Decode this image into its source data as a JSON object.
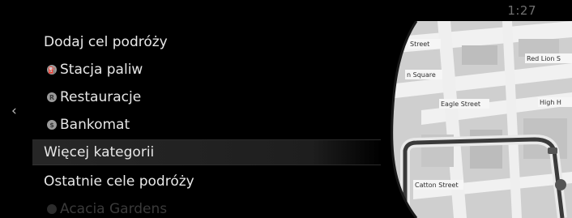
{
  "status_bar": {
    "time": "1:27"
  },
  "navigation": {
    "back_icon": "chevron-left-icon"
  },
  "menu": {
    "add_destination_header": "Dodaj cel podróży",
    "categories": [
      {
        "label": "Stacja paliw",
        "icon": "fuel-station-icon",
        "glyph": "⛽"
      },
      {
        "label": "Restauracje",
        "icon": "restaurant-icon",
        "glyph": "R"
      },
      {
        "label": "Bankomat",
        "icon": "atm-icon",
        "glyph": "$"
      }
    ],
    "more_categories": "Więcej kategorii",
    "recent_header": "Ostatnie cele podróży",
    "recent_items": [
      {
        "label": "Acacia Gardens",
        "icon": "place-icon"
      }
    ]
  },
  "map": {
    "street_labels": [
      "Street",
      "Red Lion S",
      "n Square",
      "Eagle Street",
      "High H",
      "Catton Street"
    ],
    "colors": {
      "road": "#f2f2f2",
      "block": "#c9c9c9",
      "route": "#3c3c3c",
      "background": "#d8d8d8"
    }
  },
  "colors": {
    "background": "#000000",
    "text": "#e6e6e6",
    "clock": "#6f6f6f",
    "selected_row": "#4a4a4a"
  }
}
